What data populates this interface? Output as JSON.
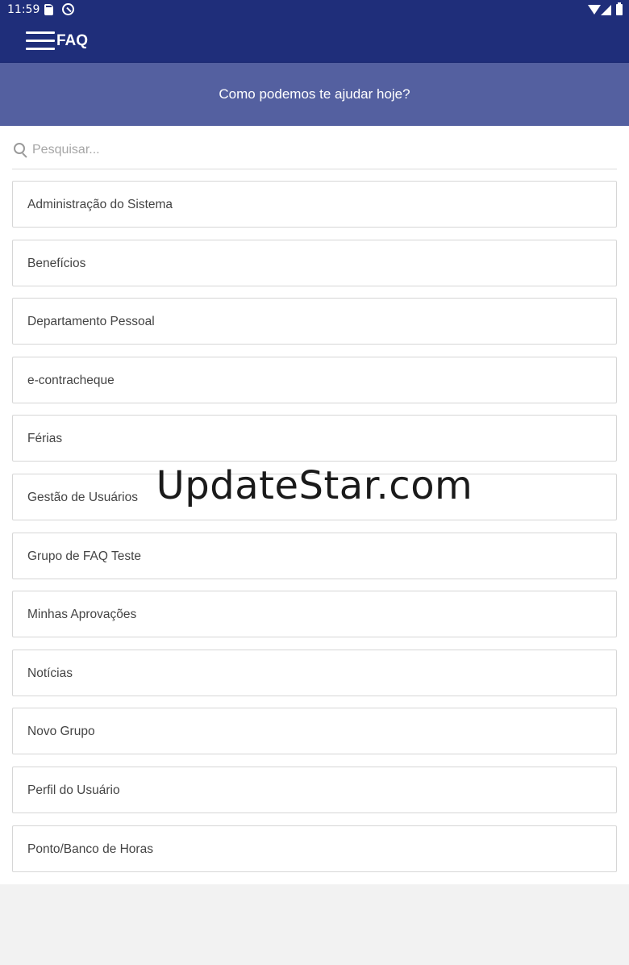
{
  "status_bar": {
    "time": "11:59",
    "icons": [
      "sd-card-icon",
      "sync-icon",
      "wifi-icon",
      "signal-icon",
      "battery-icon"
    ]
  },
  "app_bar": {
    "title": "FAQ",
    "menu_icon": "menu-icon",
    "background": "#1f2e7a"
  },
  "banner": {
    "text": "Como podemos te ajudar hoje?",
    "background": "#5460a0"
  },
  "search": {
    "placeholder": "Pesquisar...",
    "value": "",
    "icon": "search-icon"
  },
  "categories": [
    {
      "label": "Administração do Sistema"
    },
    {
      "label": "Benefícios"
    },
    {
      "label": "Departamento Pessoal"
    },
    {
      "label": "e-contracheque"
    },
    {
      "label": "Férias"
    },
    {
      "label": "Gestão de Usuários"
    },
    {
      "label": "Grupo de FAQ Teste"
    },
    {
      "label": "Minhas Aprovações"
    },
    {
      "label": "Notícias"
    },
    {
      "label": "Novo Grupo"
    },
    {
      "label": "Perfil do Usuário"
    },
    {
      "label": "Ponto/Banco de Horas"
    }
  ],
  "watermark": "UpdateStar.com"
}
